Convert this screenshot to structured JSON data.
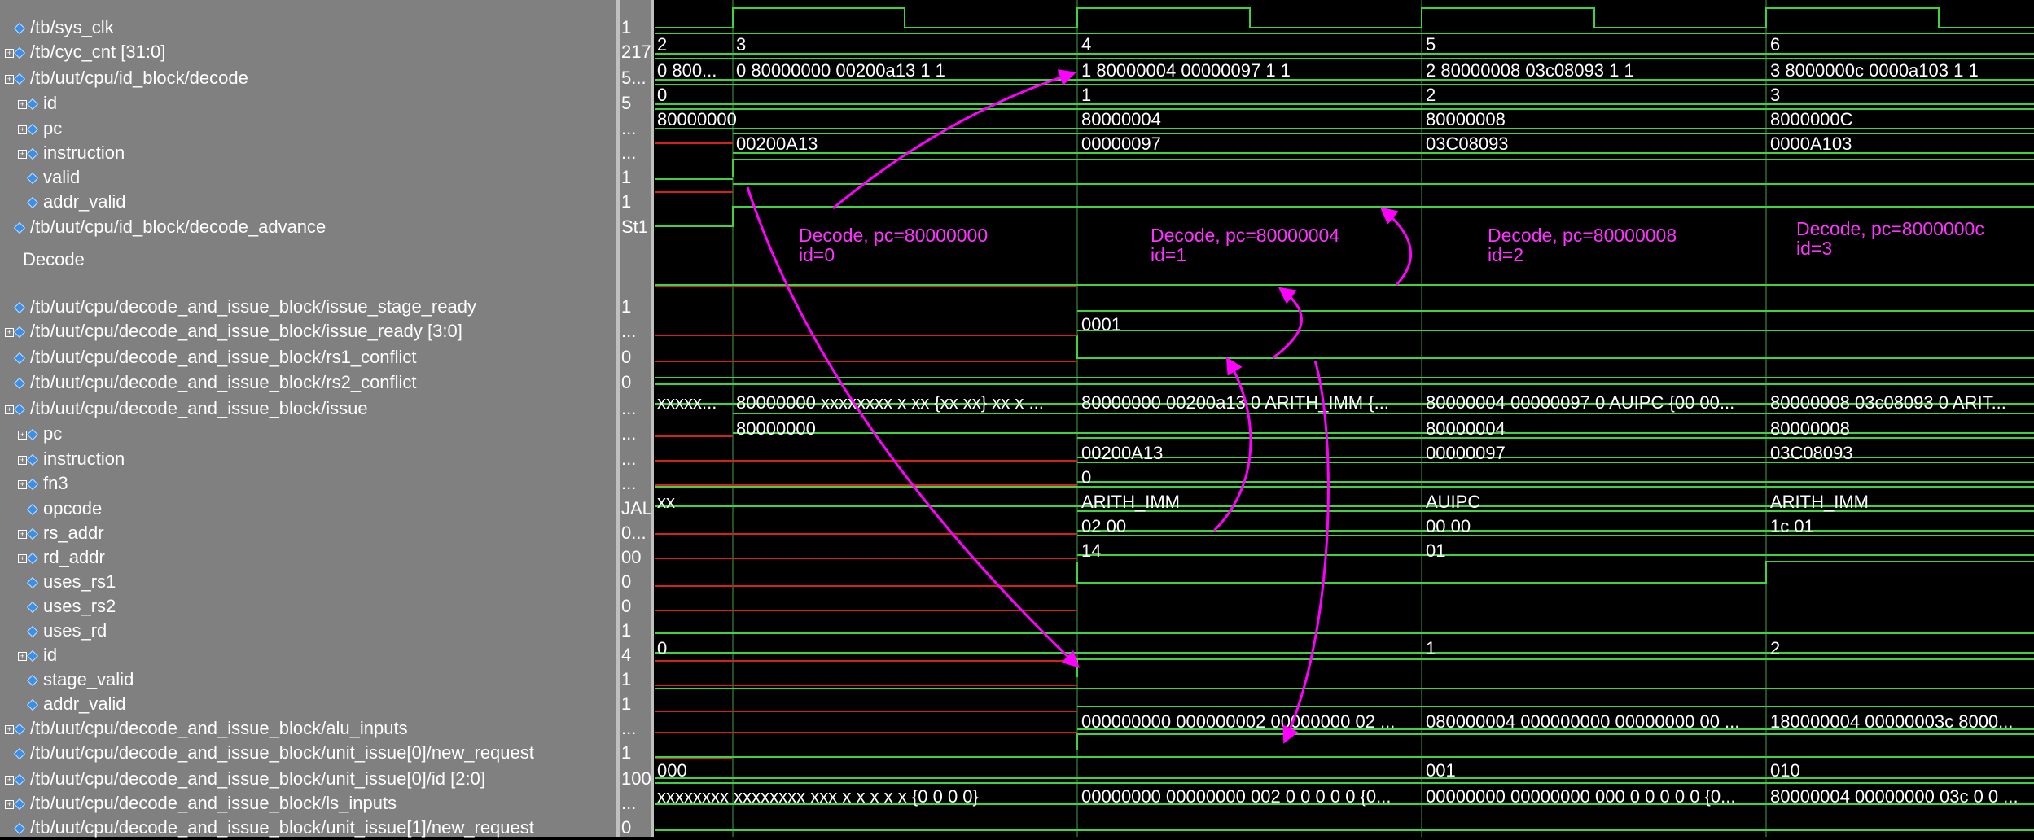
{
  "signals": [
    {
      "name": "/tb/sys_clk",
      "expandable": false,
      "value": "1"
    },
    {
      "name": "/tb/cyc_cnt [31:0]",
      "expandable": true,
      "value": "217"
    },
    {
      "name": "/tb/uut/cpu/id_block/decode",
      "expandable": true,
      "value": "5..."
    },
    {
      "name": "id",
      "expandable": true,
      "value": "5",
      "indent": 1
    },
    {
      "name": "pc",
      "expandable": true,
      "value": "...",
      "indent": 1
    },
    {
      "name": "instruction",
      "expandable": true,
      "value": "...",
      "indent": 1
    },
    {
      "name": "valid",
      "expandable": false,
      "value": "1",
      "indent": 1
    },
    {
      "name": "addr_valid",
      "expandable": false,
      "value": "1",
      "indent": 1
    },
    {
      "name": "/tb/uut/cpu/id_block/decode_advance",
      "expandable": false,
      "value": "St1"
    },
    {
      "name": "/tb/uut/cpu/decode_and_issue_block/issue_stage_ready",
      "expandable": false,
      "value": "1"
    },
    {
      "name": "/tb/uut/cpu/decode_and_issue_block/issue_ready [3:0]",
      "expandable": true,
      "value": "..."
    },
    {
      "name": "/tb/uut/cpu/decode_and_issue_block/rs1_conflict",
      "expandable": false,
      "value": "0"
    },
    {
      "name": "/tb/uut/cpu/decode_and_issue_block/rs2_conflict",
      "expandable": false,
      "value": "0"
    },
    {
      "name": "/tb/uut/cpu/decode_and_issue_block/issue",
      "expandable": true,
      "value": "..."
    },
    {
      "name": "pc",
      "expandable": true,
      "value": "...",
      "indent": 1
    },
    {
      "name": "instruction",
      "expandable": true,
      "value": "...",
      "indent": 1
    },
    {
      "name": "fn3",
      "expandable": true,
      "value": "...",
      "indent": 1
    },
    {
      "name": "opcode",
      "expandable": false,
      "value": "JAL",
      "indent": 1
    },
    {
      "name": "rs_addr",
      "expandable": true,
      "value": "0...",
      "indent": 1
    },
    {
      "name": "rd_addr",
      "expandable": true,
      "value": "00",
      "indent": 1
    },
    {
      "name": "uses_rs1",
      "expandable": false,
      "value": "0",
      "indent": 1
    },
    {
      "name": "uses_rs2",
      "expandable": false,
      "value": "0",
      "indent": 1
    },
    {
      "name": "uses_rd",
      "expandable": false,
      "value": "1",
      "indent": 1
    },
    {
      "name": "id",
      "expandable": true,
      "value": "4",
      "indent": 1
    },
    {
      "name": "stage_valid",
      "expandable": false,
      "value": "1",
      "indent": 1
    },
    {
      "name": "addr_valid",
      "expandable": false,
      "value": "1",
      "indent": 1
    },
    {
      "name": "/tb/uut/cpu/decode_and_issue_block/alu_inputs",
      "expandable": true,
      "value": "..."
    },
    {
      "name": "/tb/uut/cpu/decode_and_issue_block/unit_issue[0]/new_request",
      "expandable": false,
      "value": "1"
    },
    {
      "name": "/tb/uut/cpu/decode_and_issue_block/unit_issue[0]/id [2:0]",
      "expandable": true,
      "value": "100"
    },
    {
      "name": "/tb/uut/cpu/decode_and_issue_block/ls_inputs",
      "expandable": true,
      "value": "..."
    },
    {
      "name": "/tb/uut/cpu/decode_and_issue_block/unit_issue[1]/new_request",
      "expandable": false,
      "value": "0"
    }
  ],
  "group_label": "Decode",
  "wave_labels": [
    "2",
    "3",
    "4",
    "5",
    "6",
    "0 800...",
    "0 80000000 00200a13 1 1",
    "1 80000004 00000097 1 1",
    "2 80000008 03c08093 1 1",
    "3 8000000c 0000a103 1 1",
    "0",
    "1",
    "2",
    "3",
    "80000000",
    "80000004",
    "80000008",
    "8000000C",
    "00200A13",
    "00000097",
    "03C08093",
    "0000A103",
    "0001",
    "xxxxx...",
    "80000000 xxxxxxxx x xx {xx xx} xx x ...",
    "80000000 00200a13 0 ARITH_IMM {...",
    "80000004 00000097 0 AUIPC {00 00...",
    "80000008 03c08093 0 ARIT...",
    "80000000",
    "80000004",
    "80000008",
    "00200A13",
    "00000097",
    "03C08093",
    "0",
    "xx",
    "ARITH_IMM",
    "AUIPC",
    "ARITH_IMM",
    "02 00",
    "00 00",
    "1c 01",
    "14",
    "01",
    "0",
    "1",
    "2",
    "000000000 000000002 00000000 02 ...",
    "080000004 000000000 00000000 00 ...",
    "180000004 00000003c 8000...",
    "000",
    "001",
    "010",
    "xxxxxxxx xxxxxxxx xxx x x x x x {0 0 0 0}",
    "00000000 00000000 002 0 0 0 0 0 {0...",
    "00000000 00000000 000 0 0 0 0 0 {0...",
    "80000004 00000000 03c 0 0 ..."
  ],
  "annotations": [
    {
      "line1": "Decode, pc=80000000",
      "line2": "id=0"
    },
    {
      "line1": "Decode, pc=80000004",
      "line2": "id=1"
    },
    {
      "line1": "Decode, pc=80000008",
      "line2": "id=2"
    },
    {
      "line1": "Decode, pc=8000000c",
      "line2": "id=3"
    }
  ]
}
